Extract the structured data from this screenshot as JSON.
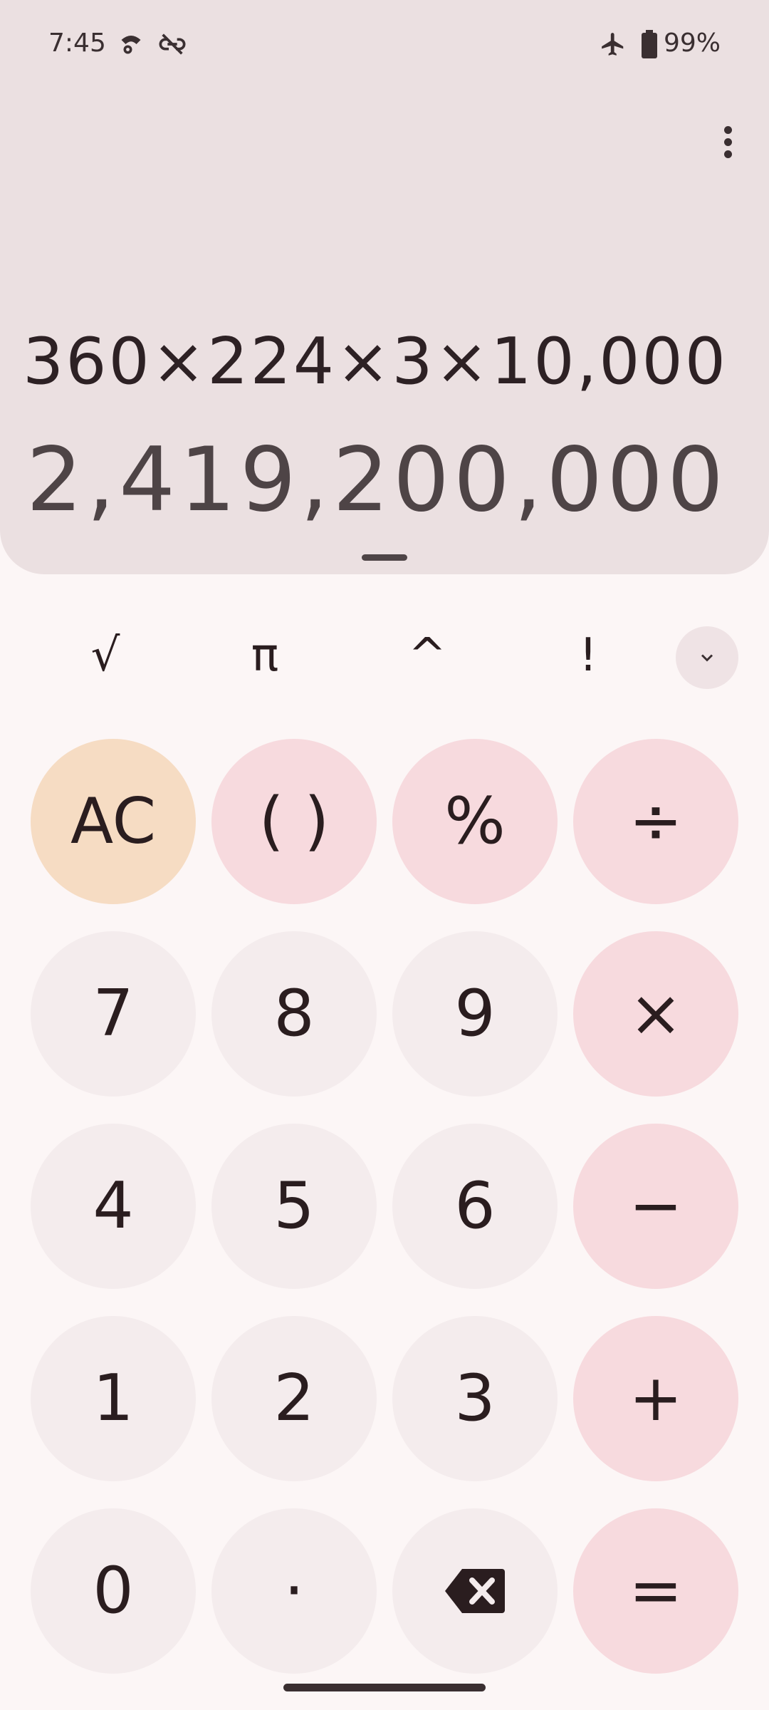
{
  "status_bar": {
    "time": "7:45",
    "battery_percent": "99%",
    "icons": [
      "settings-cast-icon",
      "link-off-icon",
      "airplane-icon",
      "battery-icon"
    ]
  },
  "display": {
    "expression": "360×224×3×10,000",
    "result": "2,419,200,000"
  },
  "scientific_row": {
    "sqrt": "√",
    "pi": "π",
    "power": "^",
    "factorial": "!"
  },
  "keypad": {
    "ac": "AC",
    "parens": "( )",
    "percent": "%",
    "divide": "÷",
    "seven": "7",
    "eight": "8",
    "nine": "9",
    "multiply": "×",
    "four": "4",
    "five": "5",
    "six": "6",
    "minus": "−",
    "one": "1",
    "two": "2",
    "three": "3",
    "plus": "+",
    "zero": "0",
    "decimal": "·",
    "equals": "="
  },
  "colors": {
    "display_bg": "#ebe0e1",
    "number_key": "#f4eced",
    "operator_key": "#f7dade",
    "clear_key": "#f6dcc3"
  }
}
